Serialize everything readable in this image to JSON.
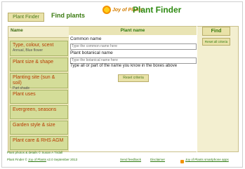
{
  "header": {
    "plant_finder_tab": "Plant Finder",
    "find_plants": "Find plants",
    "logo_text": "Joy of Plants",
    "title": "Plant Finder"
  },
  "menu": {
    "heading": "Name",
    "items": [
      {
        "title": "Type, colour, scent",
        "sub": "Annual, Blue flower"
      },
      {
        "title": "Plant size & shape",
        "sub": ""
      },
      {
        "title": "Planting site (sun & soil)",
        "sub": "Part shade"
      },
      {
        "title": "Plant uses",
        "sub": ""
      },
      {
        "title": "Evergreen, seasons",
        "sub": ""
      },
      {
        "title": "Garden style & size",
        "sub": ""
      },
      {
        "title": "Plant care & RHS AGM",
        "sub": ""
      }
    ]
  },
  "center": {
    "heading": "Plant name",
    "common_label": "Common name",
    "common_placeholder": "Type the common name here",
    "botanical_label": "Plant botanical name",
    "botanical_placeholder": "Type the botanical name here",
    "hint": "Type all or part of the name you know in the boxes above",
    "reset_criteria": "Reset criteria"
  },
  "right": {
    "find": "Find",
    "reset_all": "Reset all criteria"
  },
  "footer": {
    "credit": "Plant photos & details © Susan A Tirdall",
    "version_prefix": "Plant Finder ©",
    "version_link": "Joy of Plants",
    "version_suffix": "v2.0 September 2013",
    "feedback": "Send feedback",
    "disclaimer": "Disclaimer",
    "apps": "Joy of Plants smartphone apps"
  }
}
